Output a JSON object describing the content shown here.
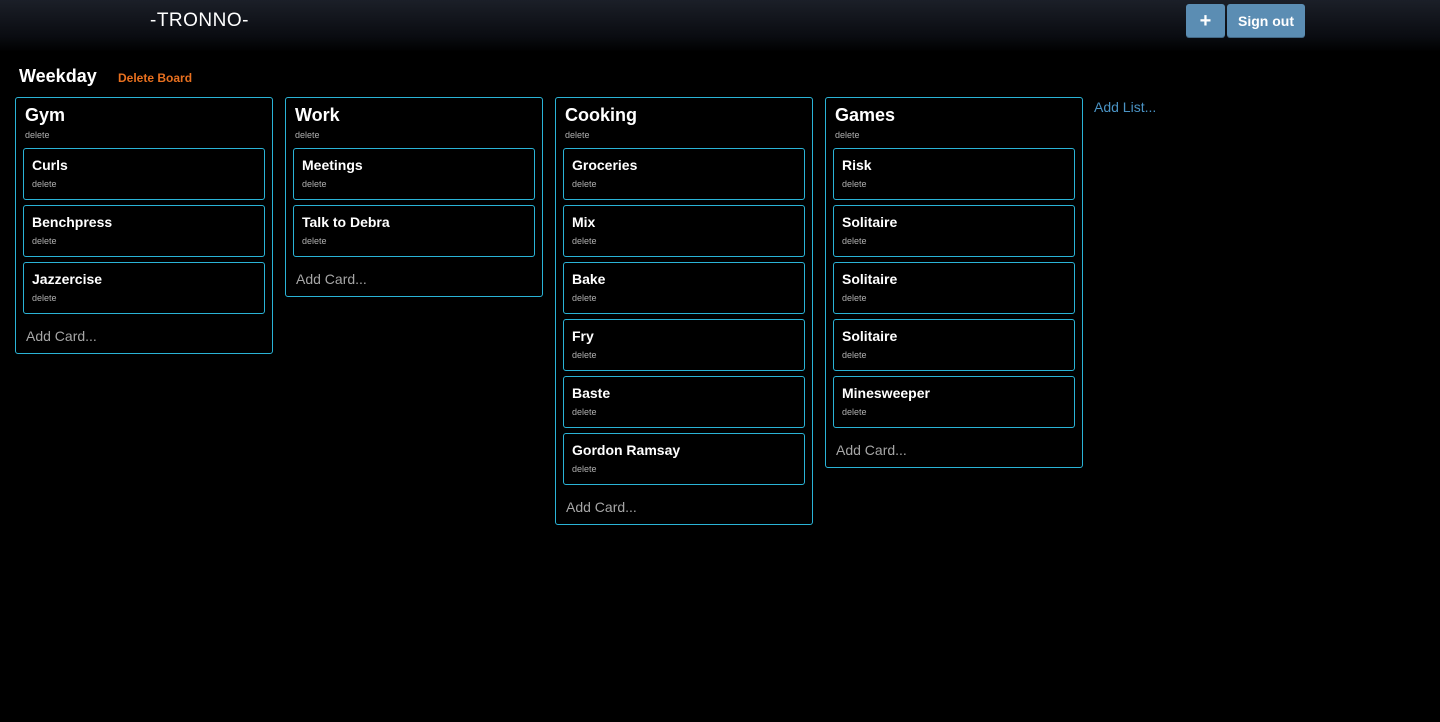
{
  "header": {
    "title": "-TRONNO-",
    "add_label": "+",
    "signout_label": "Sign out"
  },
  "board": {
    "title": "Weekday",
    "delete_label": "Delete Board",
    "add_list_label": "Add List...",
    "lists": [
      {
        "title": "Gym",
        "delete_label": "delete",
        "add_card_label": "Add Card...",
        "cards": [
          {
            "title": "Curls",
            "delete_label": "delete"
          },
          {
            "title": "Benchpress",
            "delete_label": "delete"
          },
          {
            "title": "Jazzercise",
            "delete_label": "delete"
          }
        ]
      },
      {
        "title": "Work",
        "delete_label": "delete",
        "add_card_label": "Add Card...",
        "cards": [
          {
            "title": "Meetings",
            "delete_label": "delete"
          },
          {
            "title": "Talk to Debra",
            "delete_label": "delete"
          }
        ]
      },
      {
        "title": "Cooking",
        "delete_label": "delete",
        "add_card_label": "Add Card...",
        "cards": [
          {
            "title": "Groceries",
            "delete_label": "delete"
          },
          {
            "title": "Mix",
            "delete_label": "delete"
          },
          {
            "title": "Bake",
            "delete_label": "delete"
          },
          {
            "title": "Fry",
            "delete_label": "delete"
          },
          {
            "title": "Baste",
            "delete_label": "delete"
          },
          {
            "title": "Gordon Ramsay",
            "delete_label": "delete"
          }
        ]
      },
      {
        "title": "Games",
        "delete_label": "delete",
        "add_card_label": "Add Card...",
        "cards": [
          {
            "title": "Risk",
            "delete_label": "delete"
          },
          {
            "title": "Solitaire",
            "delete_label": "delete"
          },
          {
            "title": "Solitaire",
            "delete_label": "delete"
          },
          {
            "title": "Solitaire",
            "delete_label": "delete"
          },
          {
            "title": "Minesweeper",
            "delete_label": "delete"
          }
        ]
      }
    ]
  },
  "colors": {
    "accent_border": "#2ab3d6",
    "button": "#5b8db3",
    "delete_board": "#e8701f",
    "add_list": "#4a93c4"
  }
}
